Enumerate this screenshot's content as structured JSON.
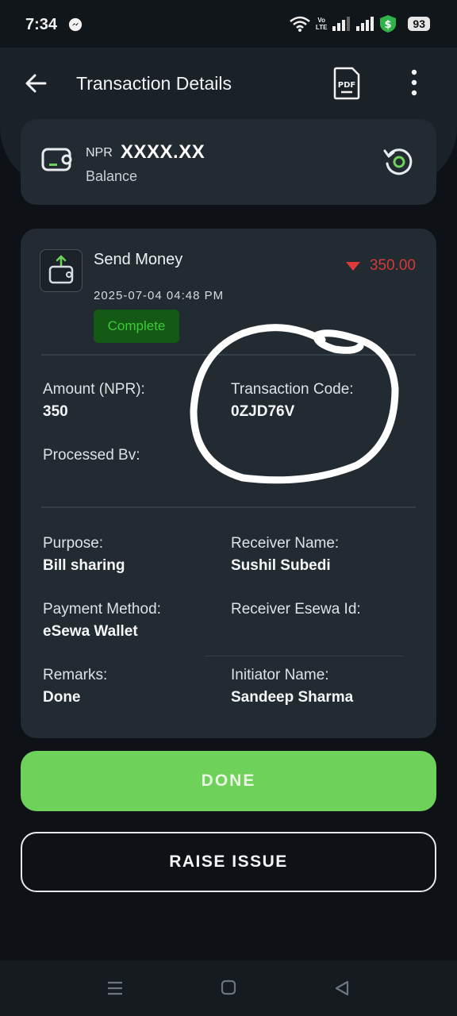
{
  "status_bar": {
    "time": "7:34",
    "network_line1": "Vo",
    "network_line2": "LTE",
    "battery": "93"
  },
  "header": {
    "title": "Transaction Details",
    "pdf_label": "PDF"
  },
  "balance": {
    "currency": "NPR",
    "amount": "XXXX.XX",
    "label": "Balance"
  },
  "transaction": {
    "type": "Send Money",
    "amount": "350.00",
    "datetime": "2025-07-04 04:48 PM",
    "status": "Complete",
    "fields": {
      "amount_label": "Amount (NPR):",
      "amount_value": "350",
      "code_label": "Transaction Code:",
      "code_value": "0ZJD76V",
      "processed_label": "Processed Bv:",
      "purpose_label": "Purpose:",
      "purpose_value": "Bill sharing",
      "receiver_label": "Receiver Name:",
      "receiver_value": "Sushil Subedi",
      "method_label": "Payment Method:",
      "method_value": "eSewa Wallet",
      "esewa_id_label": "Receiver Esewa Id:",
      "remarks_label": "Remarks:",
      "remarks_value": "Done",
      "initiator_label": "Initiator  Name:",
      "initiator_value": "Sandeep Sharma"
    }
  },
  "buttons": {
    "done": "DONE",
    "raise_issue": "RAISE ISSUE"
  },
  "colors": {
    "accent_green": "#6ed15a",
    "debit_red": "#d23a3a",
    "status_green": "#3ec93a",
    "card_bg": "#232b32",
    "page_bg": "#0e1216"
  }
}
